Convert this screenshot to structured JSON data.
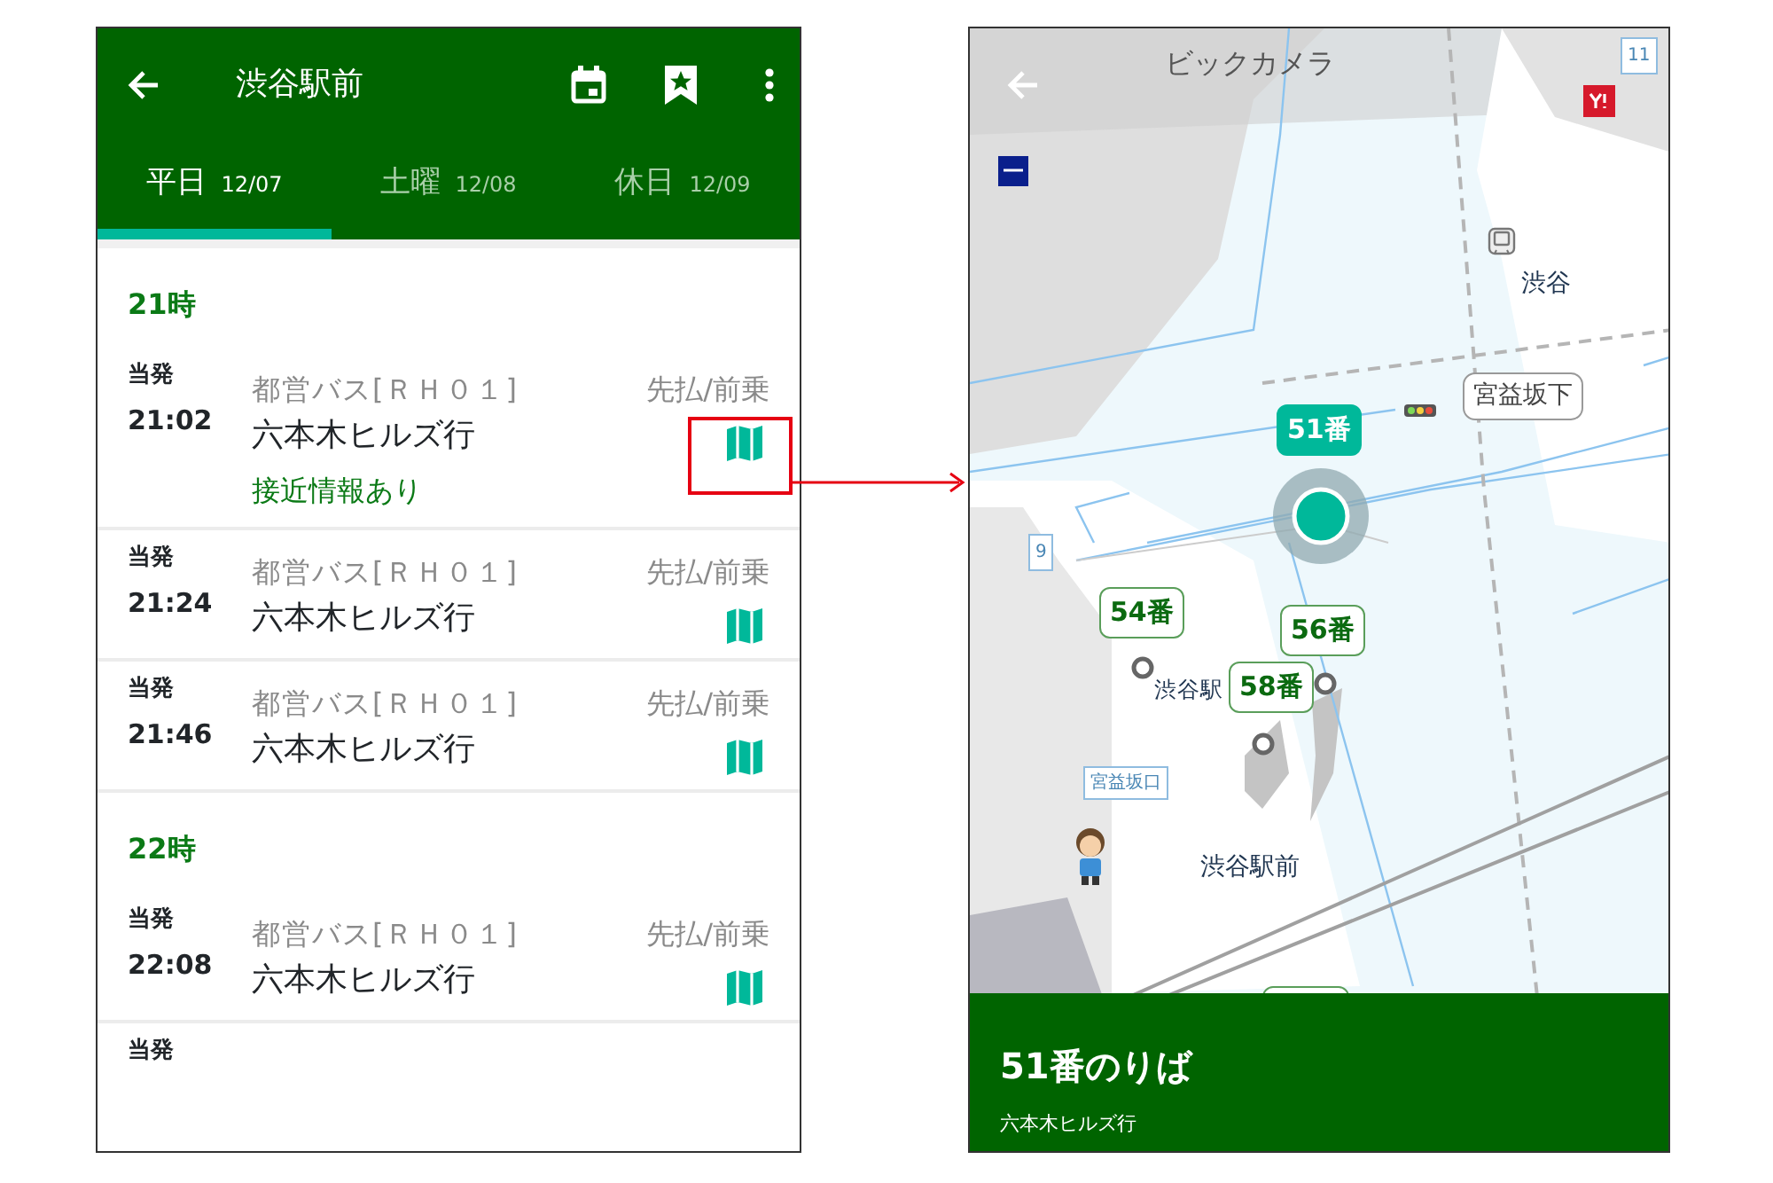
{
  "timetable_screen": {
    "app_bar": {
      "title": "渋谷駅前"
    },
    "tabs": [
      {
        "label": "平日",
        "date": "12/07",
        "selected": true
      },
      {
        "label": "土曜",
        "date": "12/08",
        "selected": false
      },
      {
        "label": "休日",
        "date": "12/09",
        "selected": false
      }
    ],
    "sections": [
      {
        "hour": "21時",
        "departures": [
          {
            "origin": "当発",
            "time": "21:02",
            "route": "都営バス[ＲＨ０１]",
            "destination": "六本木ヒルズ行",
            "boarding": "先払/前乗",
            "approach": "接近情報あり"
          },
          {
            "origin": "当発",
            "time": "21:24",
            "route": "都営バス[ＲＨ０１]",
            "destination": "六本木ヒルズ行",
            "boarding": "先払/前乗"
          },
          {
            "origin": "当発",
            "time": "21:46",
            "route": "都営バス[ＲＨ０１]",
            "destination": "六本木ヒルズ行",
            "boarding": "先払/前乗"
          }
        ]
      },
      {
        "hour": "22時",
        "departures": [
          {
            "origin": "当発",
            "time": "22:08",
            "route": "都営バス[ＲＨ０１]",
            "destination": "六本木ヒルズ行",
            "boarding": "先払/前乗"
          },
          {
            "origin": "当発"
          }
        ]
      }
    ]
  },
  "map_screen": {
    "map": {
      "labels": [
        {
          "kind": "place",
          "text": "ビックカメラ"
        },
        {
          "kind": "place",
          "text": "渋谷"
        },
        {
          "kind": "sign",
          "text": "宮益坂下"
        },
        {
          "kind": "place",
          "text": "渋谷駅"
        },
        {
          "kind": "small_sign",
          "text": "宮益坂口"
        },
        {
          "kind": "place",
          "text": "渋谷駅前"
        },
        {
          "kind": "route",
          "text": "11"
        },
        {
          "kind": "route",
          "text": "9"
        }
      ],
      "stops": [
        {
          "label": "51番",
          "selected": true
        },
        {
          "label": "54番",
          "selected": false
        },
        {
          "label": "56番",
          "selected": false
        },
        {
          "label": "58番",
          "selected": false
        }
      ]
    },
    "bottom_sheet": {
      "title": "51番のりば",
      "subtitle": "六本木ヒルズ行"
    }
  }
}
